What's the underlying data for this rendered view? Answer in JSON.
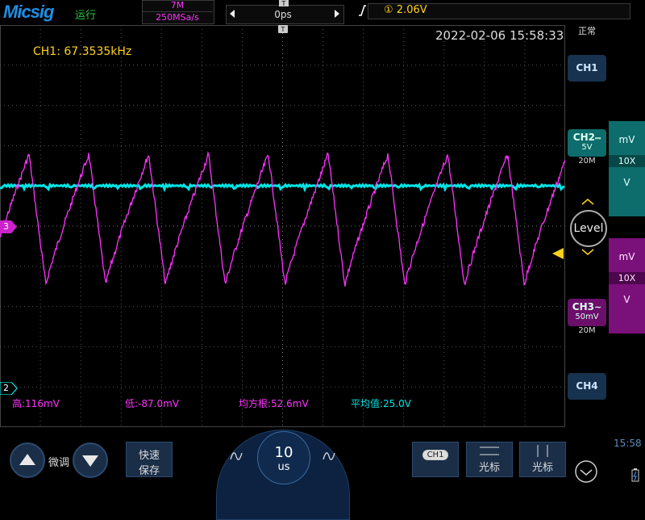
{
  "brand": "Micsig",
  "run_status": "运行",
  "acquisition": {
    "memory_depth": "7M",
    "sample_rate": "250MSa/s"
  },
  "timebase": {
    "offset": "0ps",
    "scale_value": "10",
    "scale_unit": "us"
  },
  "trigger": {
    "source_icon": "①",
    "level": "2.06V"
  },
  "mode": "正常",
  "timestamp": "2022-02-06 15:58:33",
  "frequency": "CH1: 67.3535kHz",
  "measurements": {
    "high": "高:116mV",
    "low": "低:-87.0mV",
    "rms": "均方根:52.6mV",
    "mean": "平均值:25.0V"
  },
  "channels": {
    "ch1": {
      "label": "CH1"
    },
    "ch2": {
      "label": "CH2",
      "coupling": "⎓",
      "scale": "5V",
      "bandwidth": "20M",
      "unit_small": "mV",
      "probe": "10X",
      "unit_large": "V",
      "marker": "2",
      "color": "#00e5e5"
    },
    "ch3": {
      "label": "CH3",
      "coupling": "~",
      "scale": "50mV",
      "bandwidth": "20M",
      "unit_small": "mV",
      "probe": "10X",
      "unit_large": "V",
      "marker": "3",
      "color": "#ff33ff"
    },
    "ch4": {
      "label": "CH4"
    }
  },
  "level_button": "Level",
  "bottom_bar": {
    "fine_tune": "微调",
    "quick_save": [
      "快速",
      "保存"
    ],
    "ch1_chip": "CH1",
    "cursor1": "光标",
    "cursor2": "光标",
    "clock": "15:58"
  },
  "colors": {
    "ch2": "#00e5e5",
    "ch3": "#ff33ff",
    "trigger": "#ffd21a",
    "accent": "#1d8fe6"
  }
}
